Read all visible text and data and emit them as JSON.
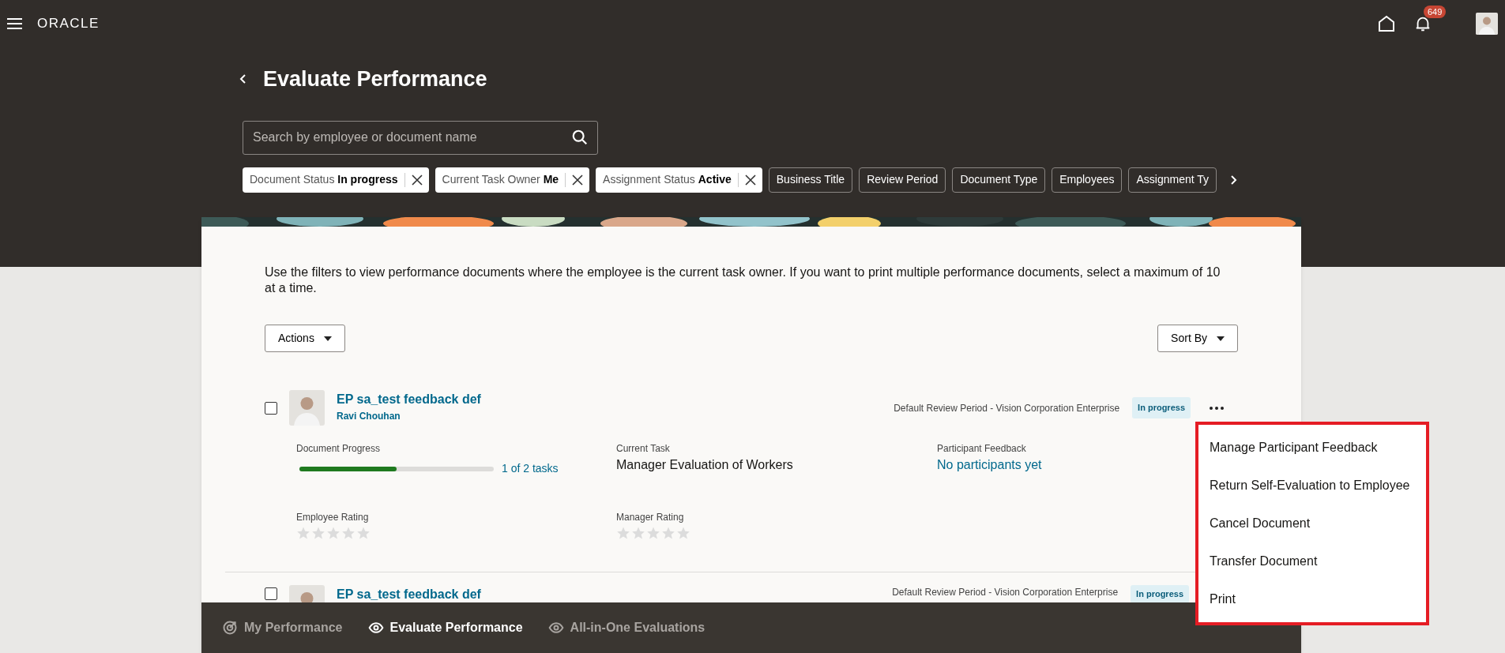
{
  "header": {
    "brand": "ORACLE",
    "title": "Evaluate Performance",
    "notifications": "649"
  },
  "search": {
    "placeholder": "Search by employee or document name"
  },
  "filters": [
    {
      "kind": "applied",
      "label": "Document Status",
      "value": "In progress"
    },
    {
      "kind": "applied",
      "label": "Current Task Owner",
      "value": "Me"
    },
    {
      "kind": "applied",
      "label": "Assignment Status",
      "value": "Active"
    },
    {
      "kind": "option",
      "label": "Business Title"
    },
    {
      "kind": "option",
      "label": "Review Period"
    },
    {
      "kind": "option",
      "label": "Document Type"
    },
    {
      "kind": "option",
      "label": "Employees"
    },
    {
      "kind": "option",
      "label": "Assignment Ty"
    }
  ],
  "card": {
    "description": "Use the filters to view performance documents where the employee is the current task owner. If you want to print multiple performance documents, select a maximum of 10 at a time.",
    "actions": "Actions",
    "sort": "Sort By"
  },
  "documents": [
    {
      "checked": false,
      "title": "EP sa_test feedback def",
      "employee": "Ravi Chouhan",
      "period": "Default Review Period - Vision Corporation Enterprise",
      "status": "In progress",
      "progress_label": "Document Progress",
      "level": 0.5,
      "progress_text": "1 of 2 tasks",
      "task_label": "Current Task",
      "task": "Manager Evaluation of Workers",
      "feedback_label": "Participant Feedback",
      "feedback": "No participants yet",
      "ratings": [
        {
          "label": "Employee Rating",
          "stars": 0
        },
        {
          "label": "Manager Rating",
          "stars": 0
        }
      ]
    },
    {
      "checked": false,
      "title": "EP sa_test feedback def",
      "period": "Default Review Period - Vision Corporation Enterprise",
      "status": "In progress"
    }
  ],
  "menu": [
    "Manage Participant Feedback",
    "Return Self-Evaluation to Employee",
    "Cancel Document",
    "Transfer Document",
    "Print"
  ],
  "bottom_nav": [
    {
      "label": "My Performance",
      "selected": false
    },
    {
      "label": "Evaluate Performance",
      "selected": true
    },
    {
      "label": "All-in-One Evaluations",
      "selected": false
    }
  ]
}
